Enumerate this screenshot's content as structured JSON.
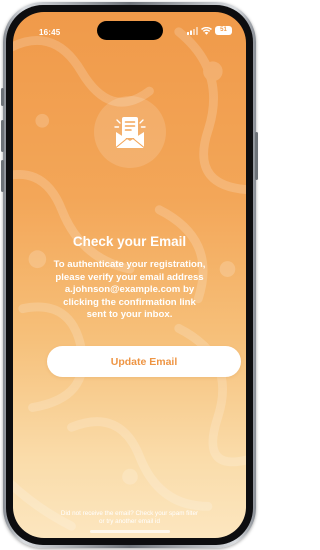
{
  "status_bar": {
    "time": "16:45",
    "battery": "51"
  },
  "content": {
    "icon": "email-envelope-icon",
    "title": "Check your Email",
    "description_lines": [
      "To authenticate your registration,",
      "please verify your email address",
      "a.johnson@example.com by",
      "clicking the confirmation link",
      "sent to your inbox."
    ],
    "update_button_label": "Update Email",
    "footer_lines": [
      "Did not receive the email? Check your spam filter",
      "or try another email id"
    ]
  },
  "colors": {
    "gradient_top": "#f09a4a",
    "gradient_bottom": "#fce6bf",
    "accent": "#ee9544",
    "text": "#ffffff"
  }
}
